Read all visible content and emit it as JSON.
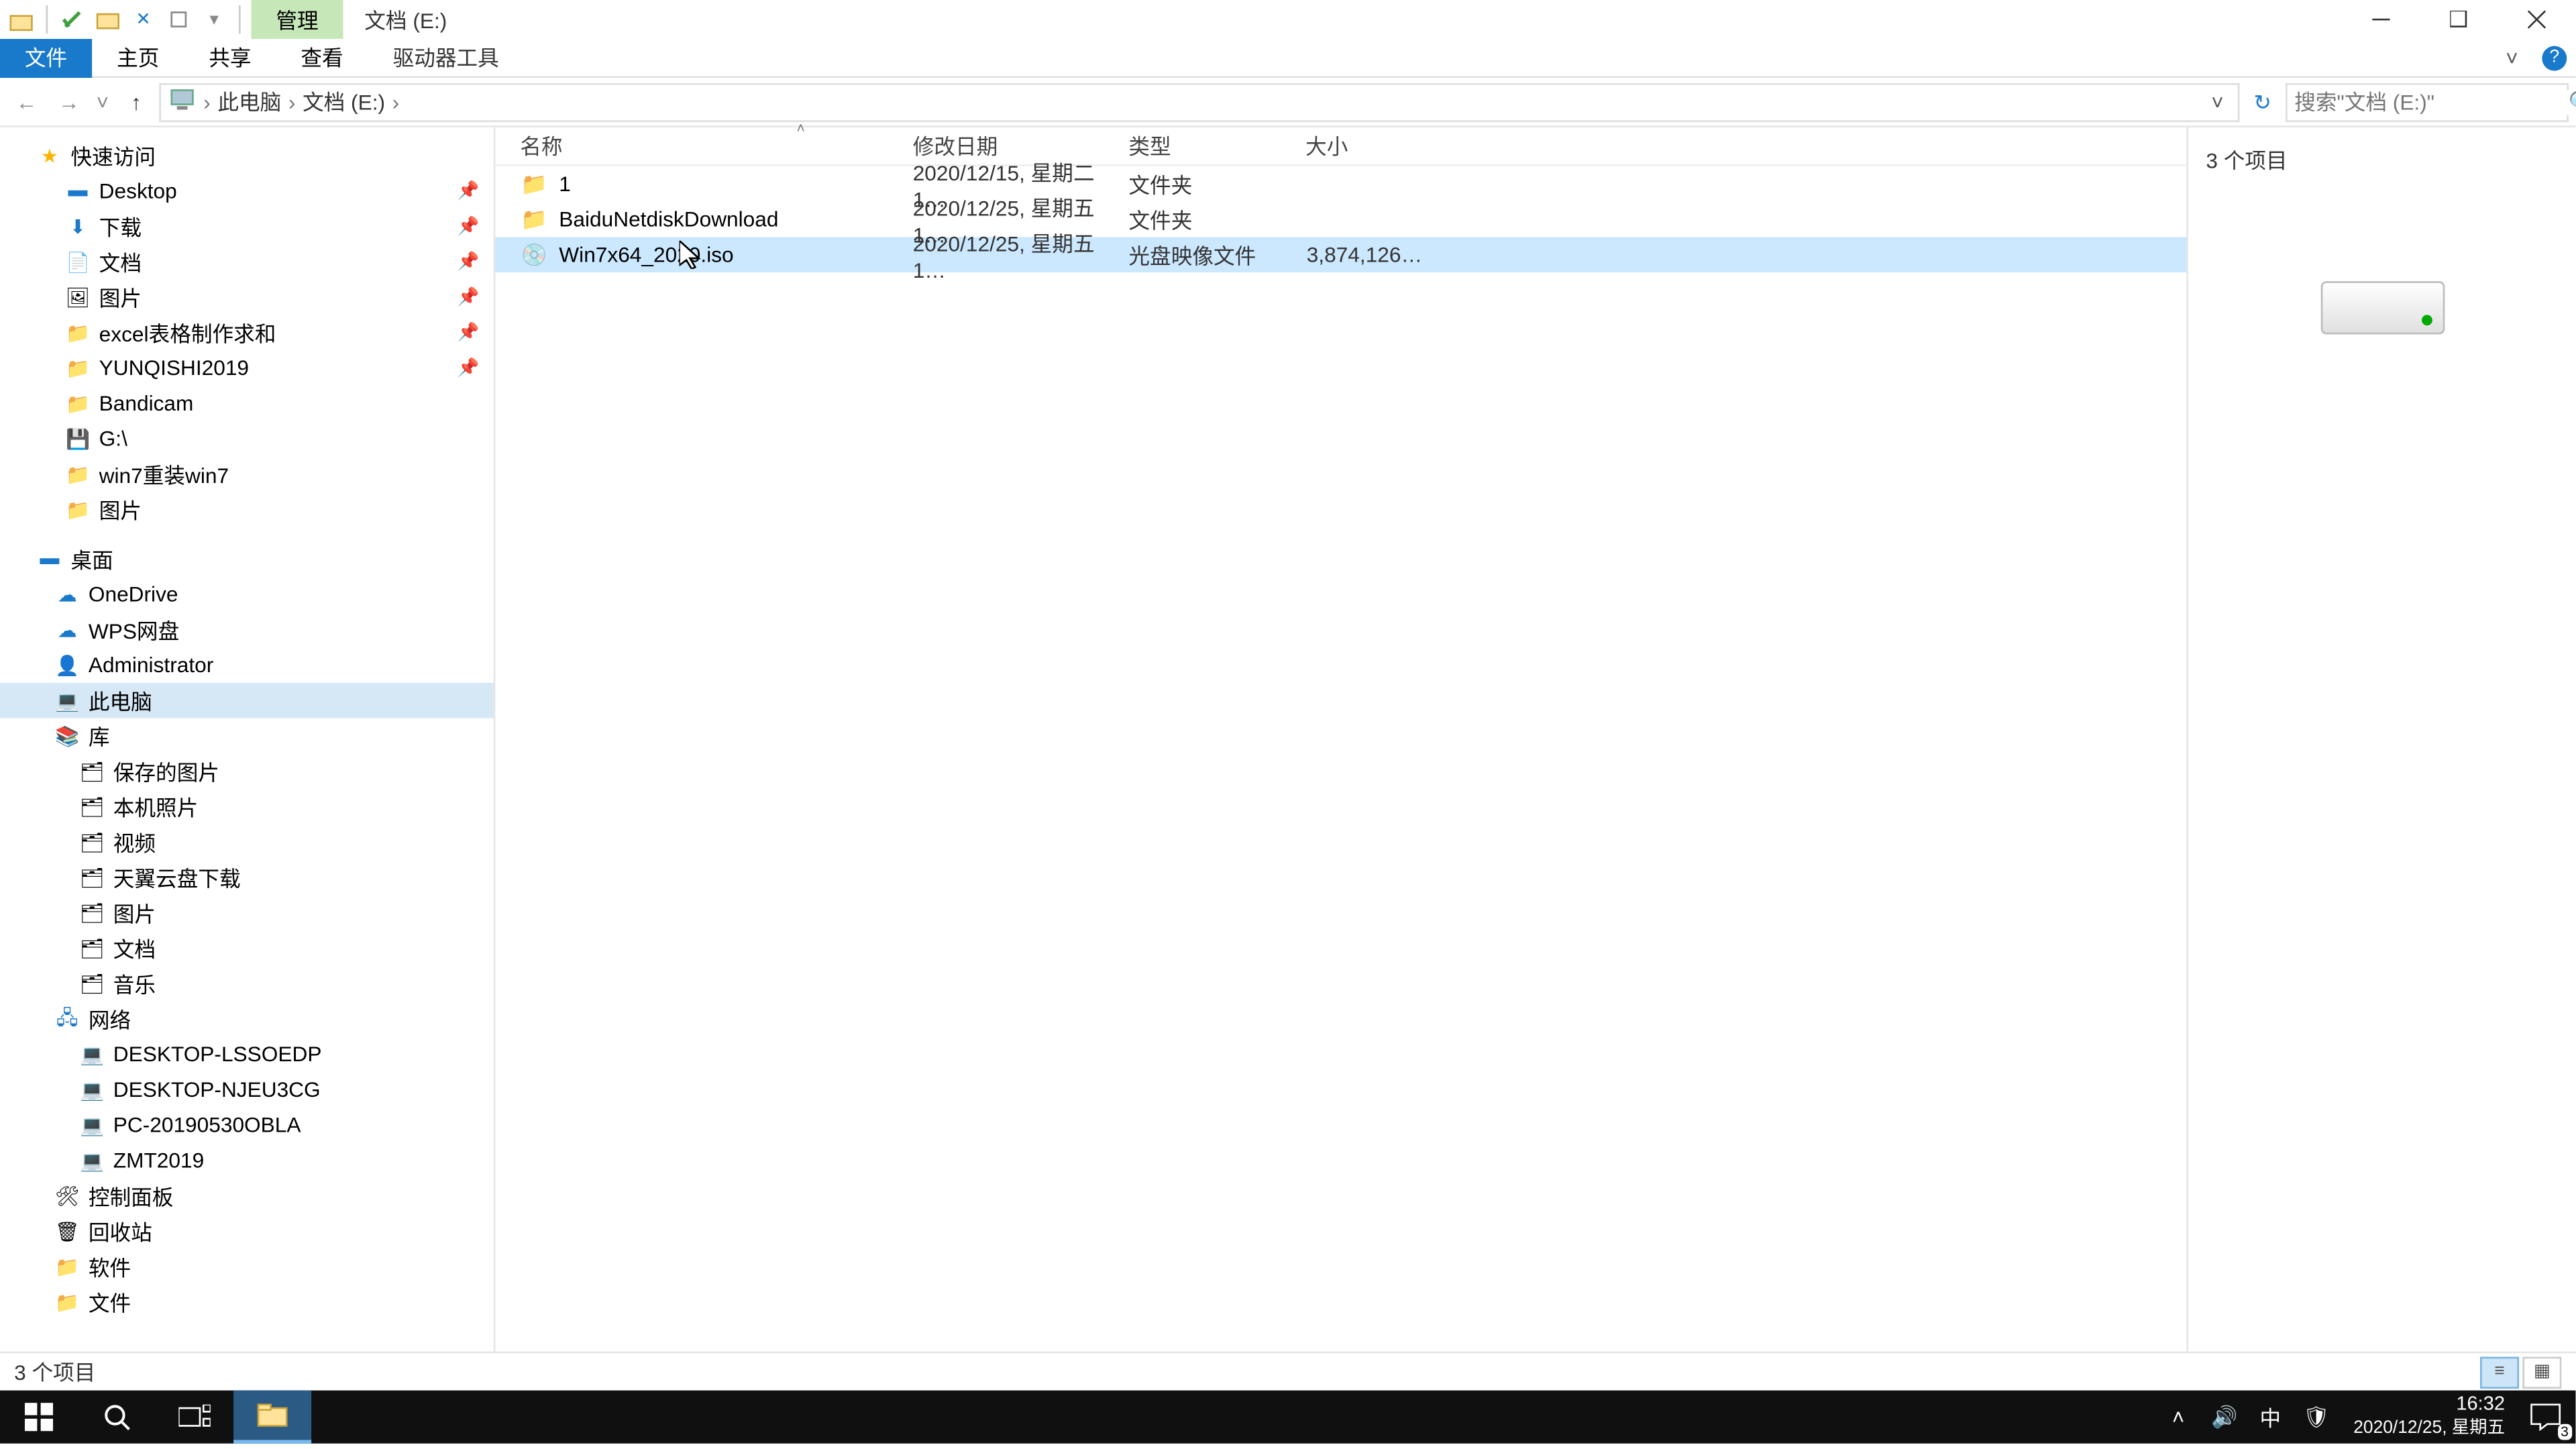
{
  "titlebar": {
    "contextual_tab": "管理",
    "window_title": "文档 (E:)"
  },
  "ribbon": {
    "file": "文件",
    "home": "主页",
    "share": "共享",
    "view": "查看",
    "drive_tools": "驱动器工具"
  },
  "address": {
    "root": "此电脑",
    "current": "文档 (E:)",
    "search_placeholder": "搜索\"文档 (E:)\""
  },
  "nav": {
    "quick_access": "快速访问",
    "qa_items": [
      {
        "label": "Desktop",
        "icon": "desktop",
        "pin": true
      },
      {
        "label": "下载",
        "icon": "downloads",
        "pin": true
      },
      {
        "label": "文档",
        "icon": "docs",
        "pin": true
      },
      {
        "label": "图片",
        "icon": "pics",
        "pin": true
      },
      {
        "label": "excel表格制作求和",
        "icon": "folder",
        "pin": true
      },
      {
        "label": "YUNQISHI2019",
        "icon": "folder",
        "pin": true
      },
      {
        "label": "Bandicam",
        "icon": "folder",
        "pin": false
      },
      {
        "label": "G:\\",
        "icon": "drive",
        "pin": false
      },
      {
        "label": "win7重装win7",
        "icon": "folder",
        "pin": false
      },
      {
        "label": "图片",
        "icon": "folder",
        "pin": false
      }
    ],
    "desktop": "桌面",
    "desktop_items": [
      {
        "label": "OneDrive",
        "icon": "cloud"
      },
      {
        "label": "WPS网盘",
        "icon": "cloud2"
      },
      {
        "label": "Administrator",
        "icon": "user"
      },
      {
        "label": "此电脑",
        "icon": "pc",
        "selected": true
      },
      {
        "label": "库",
        "icon": "lib"
      }
    ],
    "lib_items": [
      {
        "label": "保存的图片"
      },
      {
        "label": "本机照片"
      },
      {
        "label": "视频"
      },
      {
        "label": "天翼云盘下载"
      },
      {
        "label": "图片"
      },
      {
        "label": "文档"
      },
      {
        "label": "音乐"
      }
    ],
    "network": "网络",
    "net_items": [
      {
        "label": "DESKTOP-LSSOEDP"
      },
      {
        "label": "DESKTOP-NJEU3CG"
      },
      {
        "label": "PC-20190530OBLA"
      },
      {
        "label": "ZMT2019"
      }
    ],
    "cpanel": "控制面板",
    "recycle": "回收站",
    "software": "软件",
    "docs2": "文件"
  },
  "columns": {
    "name": "名称",
    "date": "修改日期",
    "type": "类型",
    "size": "大小"
  },
  "files": [
    {
      "name": "1",
      "date": "2020/12/15, 星期二 1…",
      "type": "文件夹",
      "size": "",
      "icon": "folder",
      "selected": false
    },
    {
      "name": "BaiduNetdiskDownload",
      "date": "2020/12/25, 星期五 1…",
      "type": "文件夹",
      "size": "",
      "icon": "folder",
      "selected": false
    },
    {
      "name": "Win7x64_2020.iso",
      "date": "2020/12/25, 星期五 1…",
      "type": "光盘映像文件",
      "size": "3,874,126…",
      "icon": "disc",
      "selected": true
    }
  ],
  "preview": {
    "count_label": "3 个项目"
  },
  "status": {
    "text": "3 个项目"
  },
  "taskbar": {
    "time": "16:32",
    "date": "2020/12/25, 星期五",
    "ime": "中",
    "notif_count": "3"
  }
}
